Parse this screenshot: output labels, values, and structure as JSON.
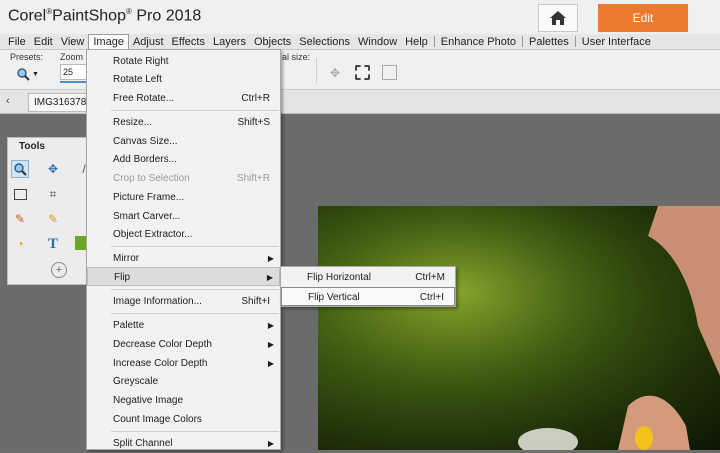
{
  "app": {
    "title": "Corel",
    "title_rest": "PaintShop",
    "title_version": "Pro 2018",
    "edit_tab": "Edit",
    "accent_color": "#ee7a30"
  },
  "menubar": {
    "items": [
      "File",
      "Edit",
      "View",
      "Image",
      "Adjust",
      "Effects",
      "Layers",
      "Objects",
      "Selections",
      "Window",
      "Help",
      "Enhance Photo",
      "Palettes",
      "User Interface"
    ]
  },
  "options": {
    "presets_label": "Presets:",
    "zoom_label": "Zoom (",
    "zoom_value": "25",
    "actual_size_label": "al size:"
  },
  "document": {
    "tab_name": "IMG316378"
  },
  "tools_palette": {
    "title": "Tools"
  },
  "image_menu": {
    "items": [
      {
        "label": "Rotate Right",
        "shortcut": ""
      },
      {
        "label": "Rotate Left",
        "shortcut": ""
      },
      {
        "label": "Free Rotate...",
        "shortcut": "Ctrl+R"
      },
      {
        "label": "Resize...",
        "shortcut": "Shift+S"
      },
      {
        "label": "Canvas Size...",
        "shortcut": ""
      },
      {
        "label": "Add Borders...",
        "shortcut": ""
      },
      {
        "label": "Crop to Selection",
        "shortcut": "Shift+R"
      },
      {
        "label": "Picture Frame...",
        "shortcut": ""
      },
      {
        "label": "Smart Carver...",
        "shortcut": ""
      },
      {
        "label": "Object Extractor...",
        "shortcut": ""
      },
      {
        "label": "Mirror",
        "shortcut": ""
      },
      {
        "label": "Flip",
        "shortcut": ""
      },
      {
        "label": "Image Information...",
        "shortcut": "Shift+I"
      },
      {
        "label": "Palette",
        "shortcut": ""
      },
      {
        "label": "Decrease Color Depth",
        "shortcut": ""
      },
      {
        "label": "Increase Color Depth",
        "shortcut": ""
      },
      {
        "label": "Greyscale",
        "shortcut": ""
      },
      {
        "label": "Negative Image",
        "shortcut": ""
      },
      {
        "label": "Count Image Colors",
        "shortcut": ""
      },
      {
        "label": "Split Channel",
        "shortcut": ""
      }
    ]
  },
  "flip_menu": {
    "items": [
      {
        "label": "Flip Horizontal",
        "shortcut": "Ctrl+M"
      },
      {
        "label": "Flip Vertical",
        "shortcut": "Ctrl+I"
      }
    ]
  }
}
